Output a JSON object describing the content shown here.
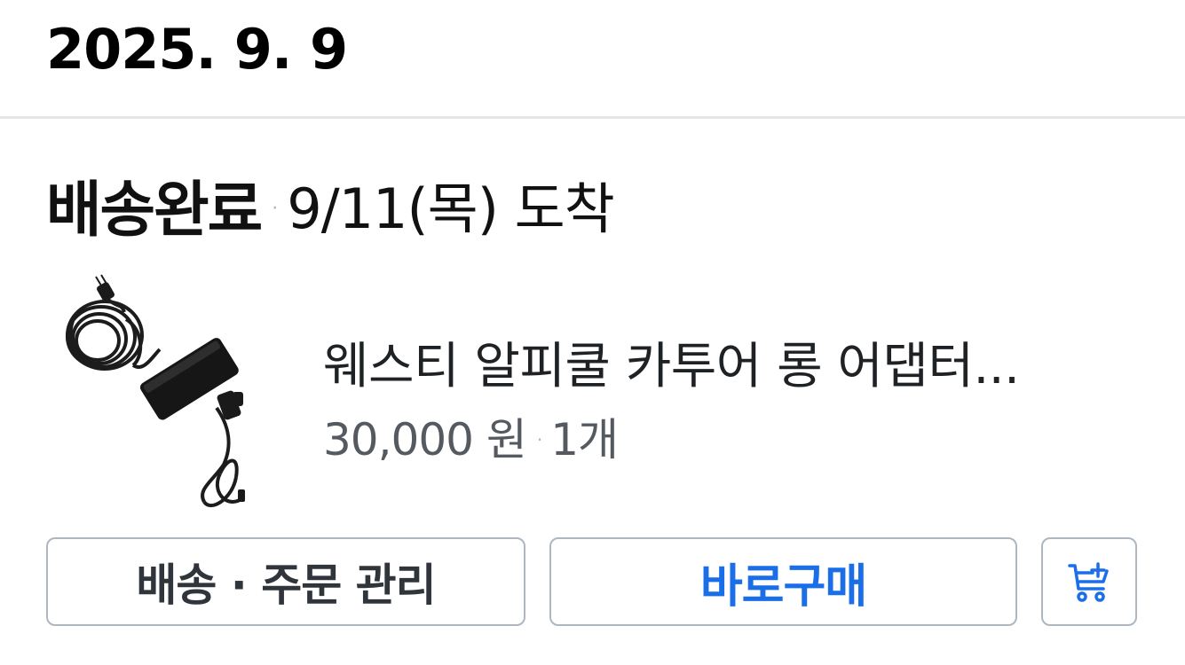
{
  "order": {
    "date": "2025. 9. 9"
  },
  "delivery": {
    "status": "배송완료",
    "separator": "·",
    "arrival": "9/11(목) 도착"
  },
  "product": {
    "image_icon": "power-adapter-image",
    "name": "웨스티 알피쿨 카투어 롱 어댑터...",
    "price": "30,000 원",
    "separator": "·",
    "quantity": "1개"
  },
  "actions": {
    "manage_label": "배송 · 주문 관리",
    "buy_label": "바로구매",
    "cart_icon": "cart-add-icon"
  },
  "colors": {
    "accent": "#1a6fe8",
    "border": "#aeb6c0",
    "divider": "#e4e6e8"
  }
}
